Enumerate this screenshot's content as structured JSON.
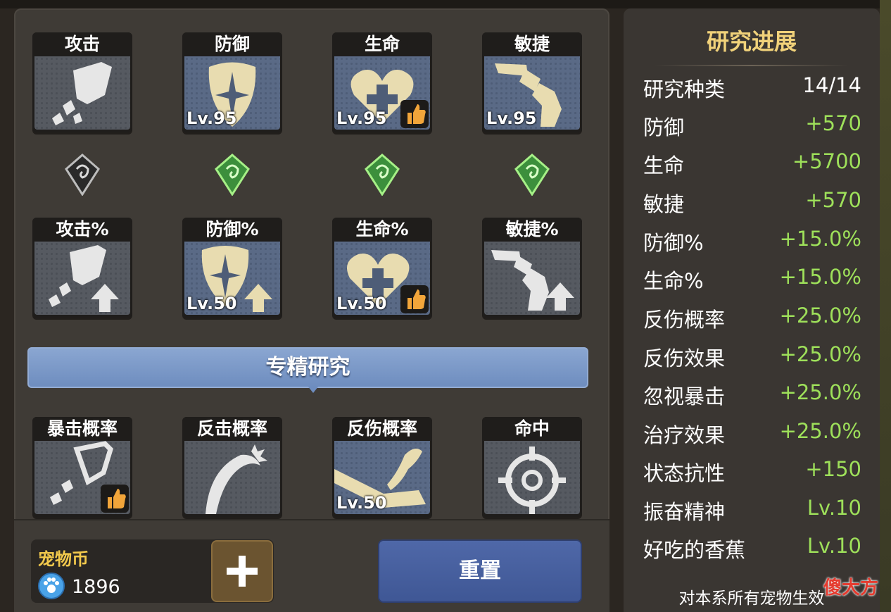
{
  "research_cards": {
    "row1": [
      {
        "title": "攻击",
        "level": "",
        "locked": true,
        "thumb": false
      },
      {
        "title": "防御",
        "level": "Lv.95",
        "locked": false,
        "thumb": false
      },
      {
        "title": "生命",
        "level": "Lv.95",
        "locked": false,
        "thumb": true
      },
      {
        "title": "敏捷",
        "level": "Lv.95",
        "locked": false,
        "thumb": false
      }
    ],
    "row2": [
      {
        "title": "攻击%",
        "level": "",
        "locked": true,
        "thumb": false
      },
      {
        "title": "防御%",
        "level": "Lv.50",
        "locked": false,
        "thumb": false
      },
      {
        "title": "生命%",
        "level": "Lv.50",
        "locked": false,
        "thumb": true
      },
      {
        "title": "敏捷%",
        "level": "",
        "locked": true,
        "thumb": false
      }
    ],
    "row3": [
      {
        "title": "暴击概率",
        "level": "",
        "locked": true,
        "thumb": true
      },
      {
        "title": "反击概率",
        "level": "",
        "locked": true,
        "thumb": false
      },
      {
        "title": "反伤概率",
        "level": "Lv.50",
        "locked": false,
        "thumb": false
      },
      {
        "title": "命中",
        "level": "",
        "locked": true,
        "thumb": false
      }
    ]
  },
  "specialization_banner": "专精研究",
  "currency": {
    "label": "宠物币",
    "value": "1896",
    "icon": "paw-coin-icon"
  },
  "reset_button_label": "重置",
  "progress_panel": {
    "title": "研究进展",
    "stats": [
      {
        "label": "研究种类",
        "value": "14/14"
      },
      {
        "label": "防御",
        "value": "+570"
      },
      {
        "label": "生命",
        "value": "+5700"
      },
      {
        "label": "敏捷",
        "value": "+570"
      },
      {
        "label": "防御%",
        "value": "+15.0%"
      },
      {
        "label": "生命%",
        "value": "+15.0%"
      },
      {
        "label": "反伤概率",
        "value": "+25.0%"
      },
      {
        "label": "反伤效果",
        "value": "+25.0%"
      },
      {
        "label": "忽视暴击",
        "value": "+25.0%"
      },
      {
        "label": "治疗效果",
        "value": "+25.0%"
      },
      {
        "label": "状态抗性",
        "value": "+150"
      },
      {
        "label": "振奋精神",
        "value": "Lv.10"
      },
      {
        "label": "好吃的香蕉",
        "value": "Lv.10"
      }
    ],
    "footer": "对本系所有宠物生效"
  },
  "watermark": "傻大方",
  "colors": {
    "accent_green": "#9ee05a",
    "gold_title": "#f1d27a",
    "banner_blue": "#7b97c8"
  }
}
